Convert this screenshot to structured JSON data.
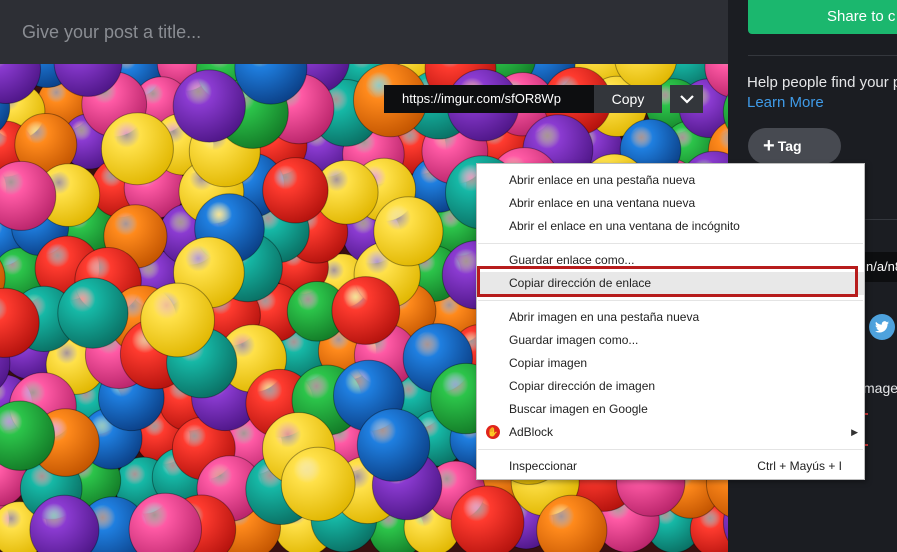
{
  "post": {
    "title_placeholder": "Give your post a title..."
  },
  "link_bar": {
    "url": "https://imgur.com/sfOR8Wp",
    "copy_label": "Copy",
    "dropdown_icon": "chevron-down-icon"
  },
  "sidebar": {
    "share_label": "Share to c",
    "help_text": "Help people find your p",
    "learn_more": "Learn More",
    "tag_label": "Tag",
    "url_fragment": "n/a/n8",
    "images_text": "mages",
    "twitter_icon": "twitter-icon"
  },
  "context_menu": {
    "groups": [
      [
        "Abrir enlace en una pestaña nueva",
        "Abrir enlace en una ventana nueva",
        "Abrir el enlace en una ventana de incógnito"
      ],
      [
        "Guardar enlace como...",
        "Copiar dirección de enlace"
      ],
      [
        "Abrir imagen en una pestaña nueva",
        "Guardar imagen como...",
        "Copiar imagen",
        "Copiar dirección de imagen",
        "Buscar imagen en Google",
        "AdBlock"
      ],
      [
        "Inspeccionar"
      ]
    ],
    "highlighted": "Copiar dirección de enlace",
    "inspect_shortcut": "Ctrl + Mayús + I"
  },
  "colors": {
    "share_green": "#1bb76e",
    "link_blue": "#3f9be8",
    "highlight_red": "#b71c1c"
  }
}
